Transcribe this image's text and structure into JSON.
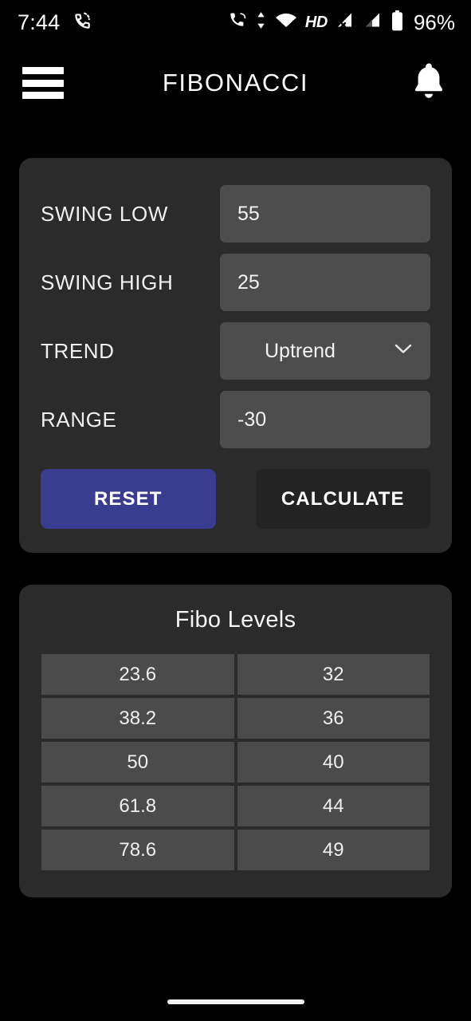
{
  "status_bar": {
    "time": "7:44",
    "battery_percent": "96%",
    "network_label": "HD",
    "wifi_level_label": "4",
    "icons": [
      "call-forwarding-icon",
      "data-transfer-icon",
      "wifi-icon",
      "hd-voice-icon",
      "signal-no-service-icon",
      "signal-bars-icon",
      "battery-icon"
    ]
  },
  "app_bar": {
    "title": "FIBONACCI",
    "menu_icon": "hamburger-menu-icon",
    "notification_icon": "bell-icon"
  },
  "form": {
    "fields": [
      {
        "label": "SWING LOW",
        "value": "55",
        "type": "text"
      },
      {
        "label": "SWING HIGH",
        "value": "25",
        "type": "text"
      },
      {
        "label": "TREND",
        "value": "Uptrend",
        "type": "select"
      },
      {
        "label": "RANGE",
        "value": "-30",
        "type": "text"
      }
    ],
    "reset_label": "RESET",
    "calculate_label": "CALCULATE"
  },
  "levels": {
    "title": "Fibo Levels",
    "rows": [
      {
        "ratio": "23.6",
        "price": "32"
      },
      {
        "ratio": "38.2",
        "price": "36"
      },
      {
        "ratio": "50",
        "price": "40"
      },
      {
        "ratio": "61.8",
        "price": "44"
      },
      {
        "ratio": "78.6",
        "price": "49"
      }
    ]
  },
  "colors": {
    "background": "#000000",
    "card": "#2b2b2b",
    "field": "#4d4d4d",
    "reset_accent": "#3a3d8f",
    "calculate": "#232323",
    "text": "#f2f2f2"
  }
}
